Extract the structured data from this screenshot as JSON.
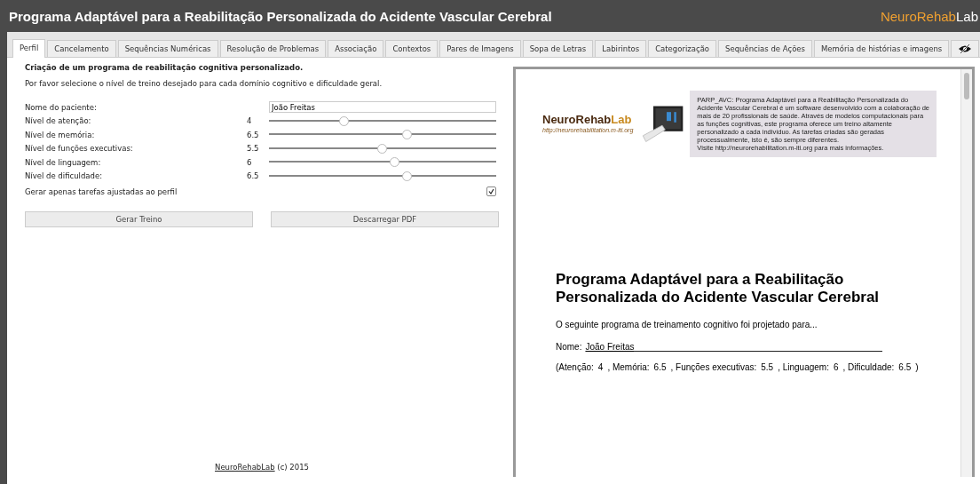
{
  "window": {
    "title": "Programa Adaptável para a Reabilitação Personalizada do Acidente Vascular Cerebral",
    "brand": {
      "main": "NeuroRehab",
      "accent": "Lab"
    }
  },
  "tabs": [
    {
      "label": "Perfil",
      "selected": true
    },
    {
      "label": "Cancelamento",
      "selected": false
    },
    {
      "label": "Sequências Numéricas",
      "selected": false
    },
    {
      "label": "Resolução de Problemas",
      "selected": false
    },
    {
      "label": "Associação",
      "selected": false
    },
    {
      "label": "Contextos",
      "selected": false
    },
    {
      "label": "Pares de Imagens",
      "selected": false
    },
    {
      "label": "Sopa de Letras",
      "selected": false
    },
    {
      "label": "Labirintos",
      "selected": false
    },
    {
      "label": "Categorização",
      "selected": false
    },
    {
      "label": "Sequências de Ações",
      "selected": false
    },
    {
      "label": "Memória de histórias e imagens",
      "selected": false
    },
    {
      "kind": "icon",
      "selected": false
    }
  ],
  "form": {
    "heading": "Criação de um programa de reabilitação cognitiva personalizado.",
    "intro": "Por favor selecione o nível de treino desejado para cada domínio cognitivo e dificuldade geral.",
    "patient": {
      "label": "Nome do paciente:",
      "value": "João Freitas"
    },
    "sliders": [
      {
        "label": "Nível de atenção:",
        "reading": "4",
        "level": 0.333
      },
      {
        "label": "Nível de memória:",
        "reading": "6.5",
        "level": 0.611
      },
      {
        "label": "Nível de funções executivas:",
        "reading": "5.5",
        "level": 0.5
      },
      {
        "label": "Nível de linguagem:",
        "reading": "6",
        "level": 0.556
      },
      {
        "label": "Nível de dificuldade:",
        "reading": "6.5",
        "level": 0.611
      }
    ],
    "option": {
      "label": "Gerar apenas tarefas ajustadas ao perfil",
      "checked": true
    },
    "buttons": [
      "Gerar Treino",
      "Descarregar PDF"
    ],
    "footer": {
      "link": "NeuroRehabLab",
      "text": "(c) 2015"
    }
  },
  "pdf": {
    "logo": {
      "main": "NeuroRehab",
      "accent": "Lab",
      "url": "http://neurorehabilitation.m-iti.org"
    },
    "about": [
      "PARP_AVC: Programa Adaptável para a Reabilitação Personalizada do Acidente Vascular Cerebral é um software desenvolvido com a colaboração de mais de 20 profissionais de saúde. Através de modelos computacionais para as funções cognitivas, este programa oferece um treino altamente personalizado a cada indivíduo. As tarefas criadas são geradas processualmente, isto é, são sempre diferentes.",
      "Visite http://neurorehabilitation.m-iti.org para mais informações."
    ],
    "title": "Programa Adaptável para a Reabilitação Personalizada do Acidente Vascular Cerebral",
    "subtitle": "O seguinte programa de treinamento cognitivo foi projetado para...",
    "name_label": "Nome:",
    "name_value": "João Freitas",
    "params": [
      {
        "label": "(Atenção:",
        "value": "4"
      },
      {
        "label": ", Memória:",
        "value": "6.5"
      },
      {
        "label": ", Funções executivas:",
        "value": "5.5"
      },
      {
        "label": ", Linguagem:",
        "value": "6"
      },
      {
        "label": ", Dificuldade:",
        "value": "6.5"
      }
    ],
    "params_end": ")"
  }
}
